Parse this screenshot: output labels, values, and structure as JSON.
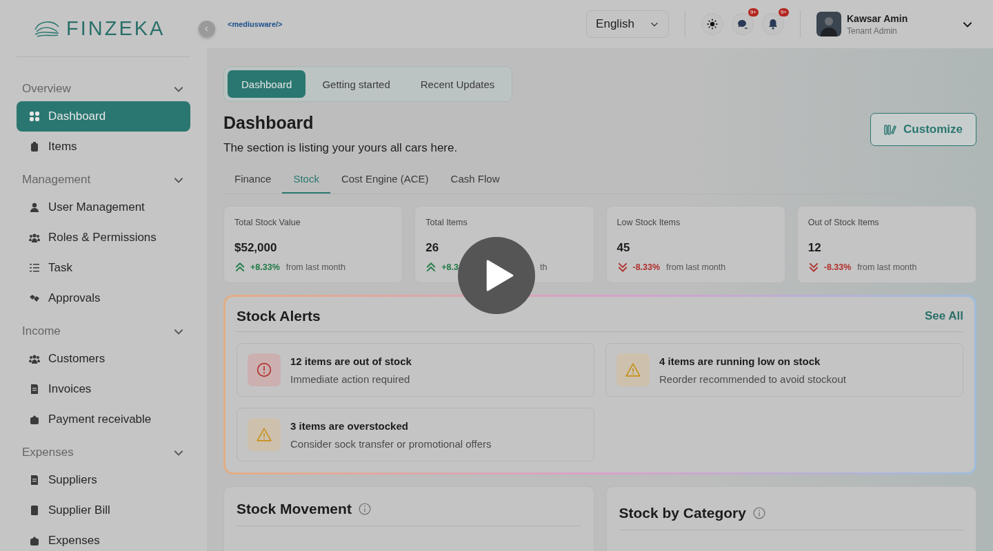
{
  "header": {
    "logo": "FINZEKA",
    "partner_logo": "<mediusware/>",
    "language": "English",
    "icons": [
      {
        "kind": "theme"
      },
      {
        "kind": "chat",
        "badge": "9+"
      },
      {
        "kind": "bell",
        "badge": "9+"
      }
    ],
    "user": {
      "name": "Kawsar Amin",
      "role": "Tenant Admin"
    }
  },
  "sidebar": {
    "sections": [
      {
        "title": "Overview",
        "expanded": true,
        "items": [
          {
            "label": "Dashboard",
            "kind": "grid",
            "selected": true
          },
          {
            "label": "Items",
            "kind": "bag",
            "selected": false
          }
        ]
      },
      {
        "title": "Management",
        "expanded": true,
        "items": [
          {
            "label": "User Management",
            "kind": "user",
            "selected": false
          },
          {
            "label": "Roles & Permissions",
            "kind": "group",
            "selected": false
          },
          {
            "label": "Task",
            "kind": "list",
            "selected": false
          },
          {
            "label": "Approvals",
            "kind": "hands",
            "selected": false
          }
        ]
      },
      {
        "title": "Income",
        "expanded": true,
        "items": [
          {
            "label": "Customers",
            "kind": "group",
            "selected": false
          },
          {
            "label": "Invoices",
            "kind": "doc",
            "selected": false
          },
          {
            "label": "Payment receivable",
            "kind": "wallet",
            "selected": false
          }
        ]
      },
      {
        "title": "Expenses",
        "expanded": true,
        "items": [
          {
            "label": "Suppliers",
            "kind": "doc",
            "selected": false
          },
          {
            "label": "Supplier Bill",
            "kind": "book",
            "selected": false
          },
          {
            "label": "Expenses",
            "kind": "wallet",
            "selected": false
          }
        ]
      }
    ]
  },
  "top_tabs": [
    {
      "label": "Dashboard",
      "selected": true
    },
    {
      "label": "Getting started",
      "selected": false
    },
    {
      "label": "Recent Updates",
      "selected": false
    }
  ],
  "page": {
    "title": "Dashboard",
    "subtitle": "The section is listing your yours all cars here.",
    "customize_button": "Customize"
  },
  "sub_tabs": [
    {
      "label": "Finance",
      "selected": false
    },
    {
      "label": "Stock",
      "selected": true
    },
    {
      "label": "Cost Engine (ACE)",
      "selected": false
    },
    {
      "label": "Cash Flow",
      "selected": false
    }
  ],
  "stats": [
    {
      "label": "Total Stock Value",
      "value": "$52,000",
      "kind": "up",
      "delta": "+8.33%",
      "note": "from last month"
    },
    {
      "label": "Total Items",
      "value": "26",
      "kind": "up",
      "delta": "+8.3",
      "note": "th"
    },
    {
      "label": "Low Stock Items",
      "value": "45",
      "kind": "down",
      "delta": "-8.33%",
      "note": "from last month"
    },
    {
      "label": "Out of Stock Items",
      "value": "12",
      "kind": "down",
      "delta": "-8.33%",
      "note": "from last month"
    }
  ],
  "stock_alerts": {
    "title": "Stock Alerts",
    "link": "See All",
    "alerts": [
      {
        "kind": "error",
        "title": "12 items are out of stock",
        "description": "Immediate action required"
      },
      {
        "kind": "warning",
        "title": "4 items are running low on stock",
        "description": "Reorder recommended to avoid stockout"
      },
      {
        "kind": "warning",
        "title": "3 items are overstocked",
        "description": "Consider sock transfer or promotional offers"
      }
    ]
  },
  "panels": [
    {
      "title": "Stock Movement"
    },
    {
      "title": "Stock by Category"
    }
  ]
}
